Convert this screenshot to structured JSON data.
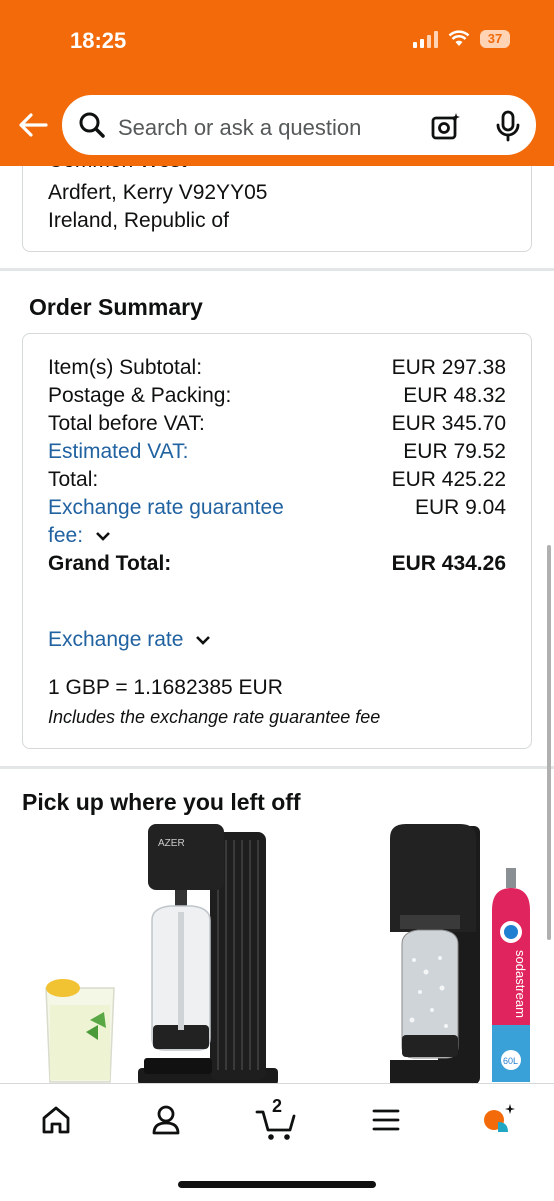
{
  "status_bar": {
    "time": "18:25",
    "battery": "37"
  },
  "search": {
    "placeholder": "Search or ask a question"
  },
  "address": {
    "partial_line": "Common West",
    "line_city": "Ardfert, Kerry V92YY05",
    "line_country": "Ireland, Republic of"
  },
  "order_summary": {
    "title": "Order Summary",
    "rows": [
      {
        "label": "Item(s) Subtotal:",
        "value": "EUR 297.38"
      },
      {
        "label": "Postage & Packing:",
        "value": "EUR 48.32"
      },
      {
        "label": "Total before VAT:",
        "value": "EUR 345.70"
      },
      {
        "label": "Estimated VAT:",
        "value": "EUR 79.52"
      },
      {
        "label": "Total:",
        "value": "EUR 425.22"
      },
      {
        "label_line1": "Exchange rate guarantee",
        "label_line2": "fee:",
        "value": "EUR 9.04"
      }
    ],
    "grand_total": {
      "label": "Grand Total:",
      "value": "EUR 434.26"
    },
    "exchange_rate_link": "Exchange rate",
    "exchange_rate_value": "1 GBP = 1.1682385 EUR",
    "exchange_rate_note": "Includes the exchange rate guarantee fee"
  },
  "pickup": {
    "title": "Pick up where you left off",
    "products": [
      {
        "brand_text": "AZER"
      },
      {
        "brand_text": "sodastream",
        "badge": "60L"
      }
    ]
  },
  "bottom_nav": {
    "cart_count": "2"
  },
  "colors": {
    "header": "#f26a0a",
    "link": "#2162a1",
    "text": "#0f1111"
  }
}
